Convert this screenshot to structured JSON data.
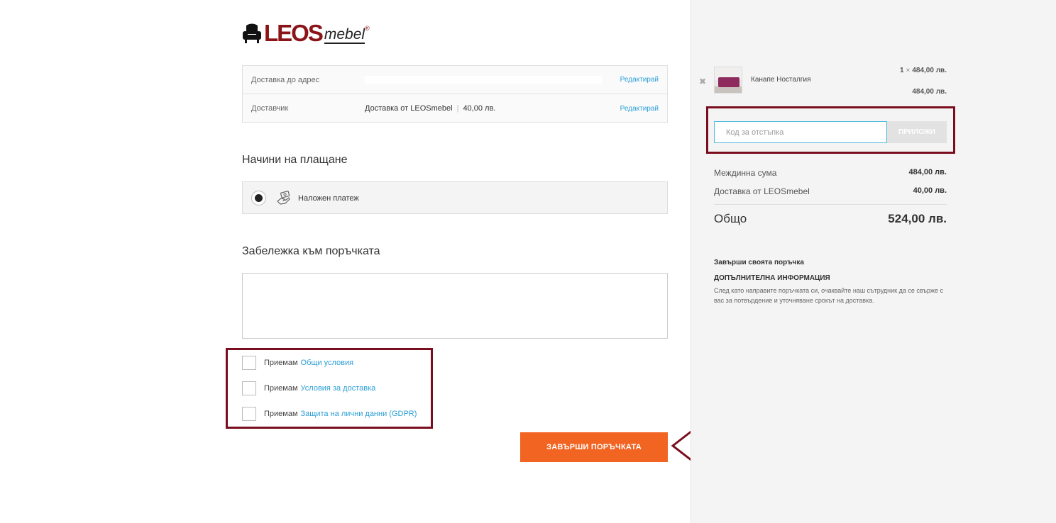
{
  "logo": {
    "text_main": "LEOS",
    "text_sub": "mebel",
    "reg": "®",
    "brand_color": "#8b1418"
  },
  "shipping": {
    "address_label": "Доставка до адрес",
    "address_value": "",
    "carrier_label": "Доставчик",
    "carrier_value": "Доставка от LEOSmebel",
    "carrier_price": "40,00 лв.",
    "edit_label": "Редактирай"
  },
  "payment": {
    "heading": "Начини на плащане",
    "method_label": "Наложен платеж",
    "method_icon": "cash-hand-icon"
  },
  "note": {
    "heading": "Забележка към поръчката",
    "value": ""
  },
  "terms": [
    {
      "prefix": "Приемам",
      "link": "Общи условия"
    },
    {
      "prefix": "Приемам",
      "link": "Условия за доставка"
    },
    {
      "prefix": "Приемам",
      "link": "Защита на лични данни (GDPR)"
    }
  ],
  "finish_button": "ЗАВЪРШИ ПОРЪЧКАТА",
  "cart": {
    "product_name": "Канапе Носталгия",
    "qty": "1",
    "times": "×",
    "unit_price": "484,00 лв.",
    "line_total": "484,00 лв.",
    "remove_icon": "close-icon"
  },
  "coupon": {
    "placeholder": "Код за отстъпка",
    "apply_label": "ПРИЛОЖИ"
  },
  "summary": {
    "subtotal_label": "Междинна сума",
    "subtotal_value": "484,00 лв.",
    "shipping_label": "Доставка от LEOSmebel",
    "shipping_value": "40,00 лв.",
    "total_label": "Общо",
    "total_value": "524,00 лв."
  },
  "info": {
    "title": "Завърши своята поръчка",
    "subtitle": "ДОПЪЛНИТЕЛНА ИНФОРМАЦИЯ",
    "text": "След като направите поръчката си, очаквайте наш сътрудник да се свърже с вас за потвърдение и уточняване срокът на доставка."
  },
  "colors": {
    "accent_orange": "#f26422",
    "link_blue": "#2a9fd6",
    "highlight_frame": "#7a0d1e"
  }
}
